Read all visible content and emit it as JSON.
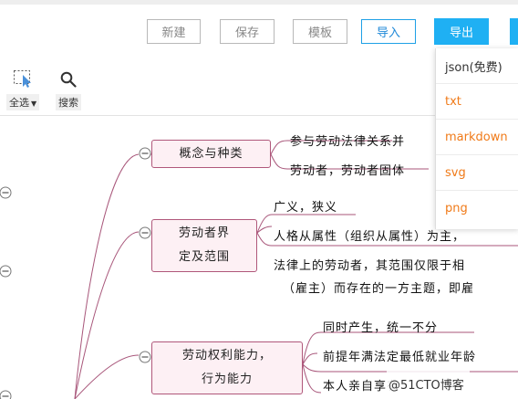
{
  "toolbar": {
    "buttons": {
      "new": "新建",
      "save": "保存",
      "template": "模板",
      "import": "导入",
      "export": "导出"
    },
    "tools": {
      "select_all": "全选",
      "search": "搜索"
    }
  },
  "export_menu": {
    "items": [
      "json(免费)",
      "txt",
      "markdown",
      "svg",
      "png"
    ]
  },
  "mindmap": {
    "branches": [
      {
        "label": "概念与种类",
        "children": [
          "参与劳动法律关系并",
          "劳动者，劳动者固体"
        ]
      },
      {
        "label_lines": [
          "劳动者界",
          "定及范围"
        ],
        "children": [
          "广义，狭义",
          "人格从属性（组织从属性）为主，",
          "法律上的劳动者，其范围仅限于相",
          "（雇主）而存在的一方主题，即雇"
        ]
      },
      {
        "label_lines": [
          "劳动权利能力，",
          "行为能力"
        ],
        "children": [
          "同时产生，统一不分",
          "前提年满法定最低就业年龄",
          "本人亲自享有"
        ]
      }
    ]
  },
  "watermark": "@51CTO博客",
  "colors": {
    "accent_blue": "#1fb0f3",
    "export_item_orange": "#f07a18",
    "node_border": "#b0577a",
    "node_fill": "#fdf0f4",
    "connector": "#a8567a"
  }
}
